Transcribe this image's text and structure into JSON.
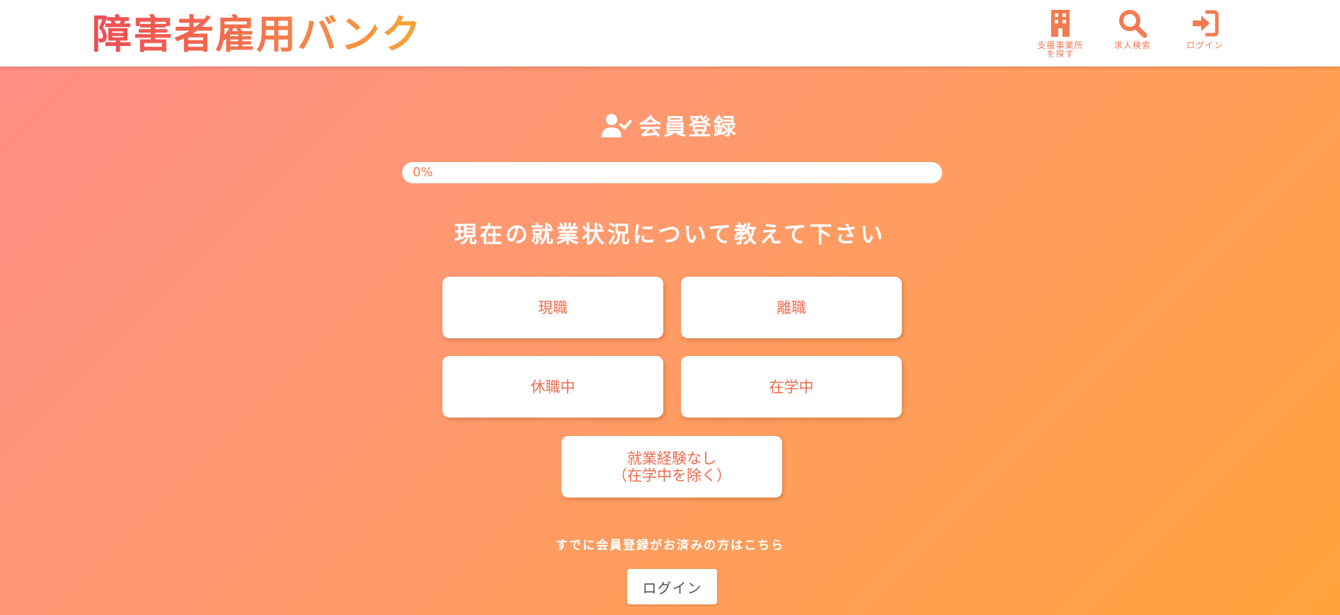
{
  "header": {
    "logo_text": "障害者雇用バンク",
    "nav": [
      {
        "label": "支援事業所\nを探す",
        "icon": "building-icon"
      },
      {
        "label": "求人検索",
        "icon": "search-icon"
      },
      {
        "label": "ログイン",
        "icon": "sign-in-icon"
      }
    ]
  },
  "main": {
    "title": "会員登録",
    "title_icon": "user-check-icon",
    "progress": {
      "value": 0,
      "label": "0%"
    },
    "question": "現在の就業状況について教えて下さい",
    "options": [
      {
        "label": "現職"
      },
      {
        "label": "離職"
      },
      {
        "label": "休職中"
      },
      {
        "label": "在学中"
      },
      {
        "label": "就業経験なし\n（在学中を除く）"
      }
    ],
    "already_text": "すでに会員登録がお済みの方はこちら",
    "login_button": "ログイン"
  },
  "colors": {
    "accent": "#f47a52",
    "gradient_start": "#ff8c87",
    "gradient_end": "#ffa43c",
    "white": "#ffffff"
  }
}
